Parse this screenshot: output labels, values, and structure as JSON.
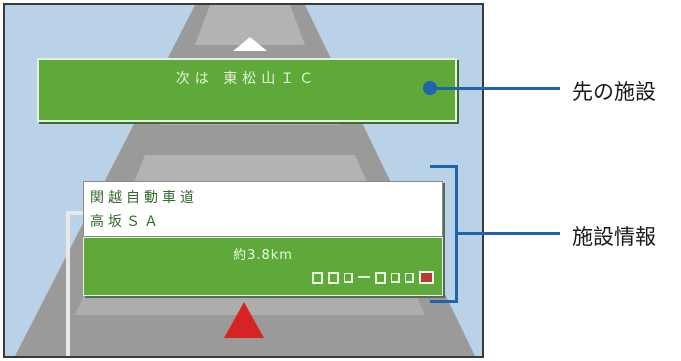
{
  "navigation_screen": {
    "next_facility_text": "次は 東松山ＩＣ",
    "facility_info": {
      "road_name": "関越自動車道",
      "facility_name": "高坂ＳＡ",
      "distance": "約3.8km",
      "service_icons": [
        "toilet-icon",
        "shop-icon",
        "restaurant-icon",
        "gas-icon",
        "info-icon",
        "food-icon",
        "rest-icon",
        "flag-icon"
      ]
    }
  },
  "annotations": {
    "next_facility_label": "先の施設",
    "facility_info_label": "施設情報"
  },
  "colors": {
    "sky": "#b9d2e8",
    "banner_green": "#5fa83a",
    "callout_blue": "#1f64ad",
    "current_position_red": "#d62424"
  }
}
